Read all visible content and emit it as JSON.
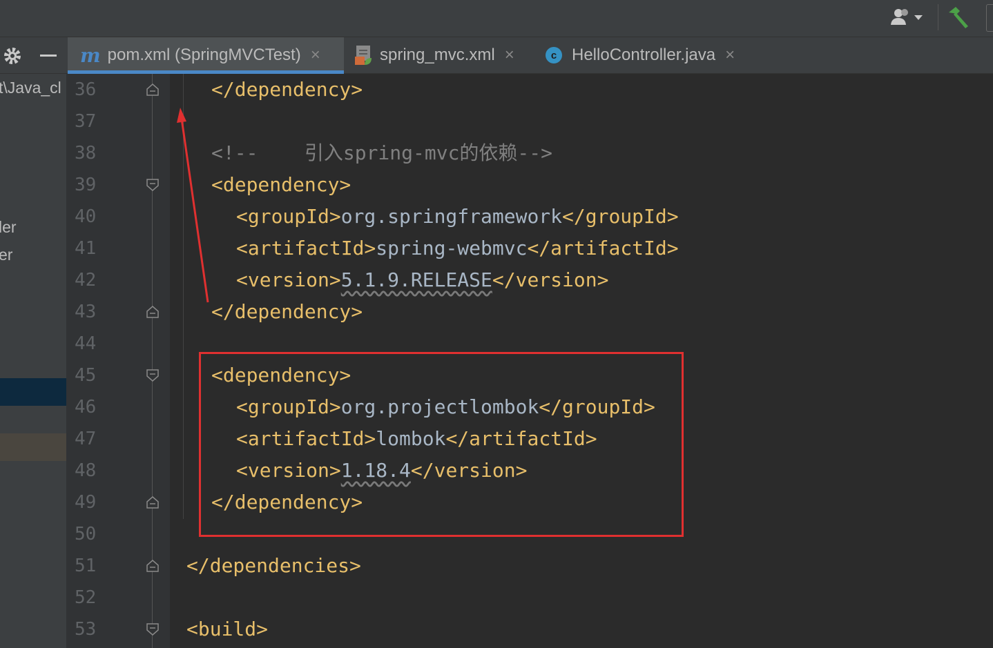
{
  "sidebar": {
    "path_fragment": "t\\Java_cl",
    "item1": "ler",
    "item2": "er"
  },
  "tabs": [
    {
      "label": "pom.xml (SpringMVCTest)",
      "icon": "maven-icon",
      "active": true
    },
    {
      "label": "spring_mvc.xml",
      "icon": "xml-file-icon",
      "active": false
    },
    {
      "label": "HelloController.java",
      "icon": "java-class-icon",
      "active": false
    }
  ],
  "icons": {
    "m_glyph": "m",
    "c_glyph": "c",
    "close_glyph": "×"
  },
  "colors": {
    "accent": "#4a88c7",
    "annotation": "#e03030",
    "tag": "#e8bf6a",
    "text": "#a9b7c6"
  },
  "lines": {
    "n36": "36",
    "n37": "37",
    "n38": "38",
    "n39": "39",
    "n40": "40",
    "n41": "41",
    "n42": "42",
    "n43": "43",
    "n44": "44",
    "n45": "45",
    "n46": "46",
    "n47": "47",
    "n48": "48",
    "n49": "49",
    "n50": "50",
    "n51": "51",
    "n52": "52",
    "n53": "53"
  },
  "code": {
    "l36": "</dependency>",
    "l38_comment": "<!--    引入spring-mvc的依赖-->",
    "l39": "<dependency>",
    "l40_open": "<groupId>",
    "l40_val": "org.springframework",
    "l40_close": "</groupId>",
    "l41_open": "<artifactId>",
    "l41_val": "spring-webmvc",
    "l41_close": "</artifactId>",
    "l42_open": "<version>",
    "l42_val": "5.1.9.RELEASE",
    "l42_close": "</version>",
    "l43": "</dependency>",
    "l45": "<dependency>",
    "l46_open": "<groupId>",
    "l46_val": "org.projectlombok",
    "l46_close": "</groupId>",
    "l47_open": "<artifactId>",
    "l47_val": "lombok",
    "l47_close": "</artifactId>",
    "l48_open": "<version>",
    "l48_val": "1.18.4",
    "l48_close": "</version>",
    "l49": "</dependency>",
    "l51": "</dependencies>",
    "l53": "<build>"
  }
}
